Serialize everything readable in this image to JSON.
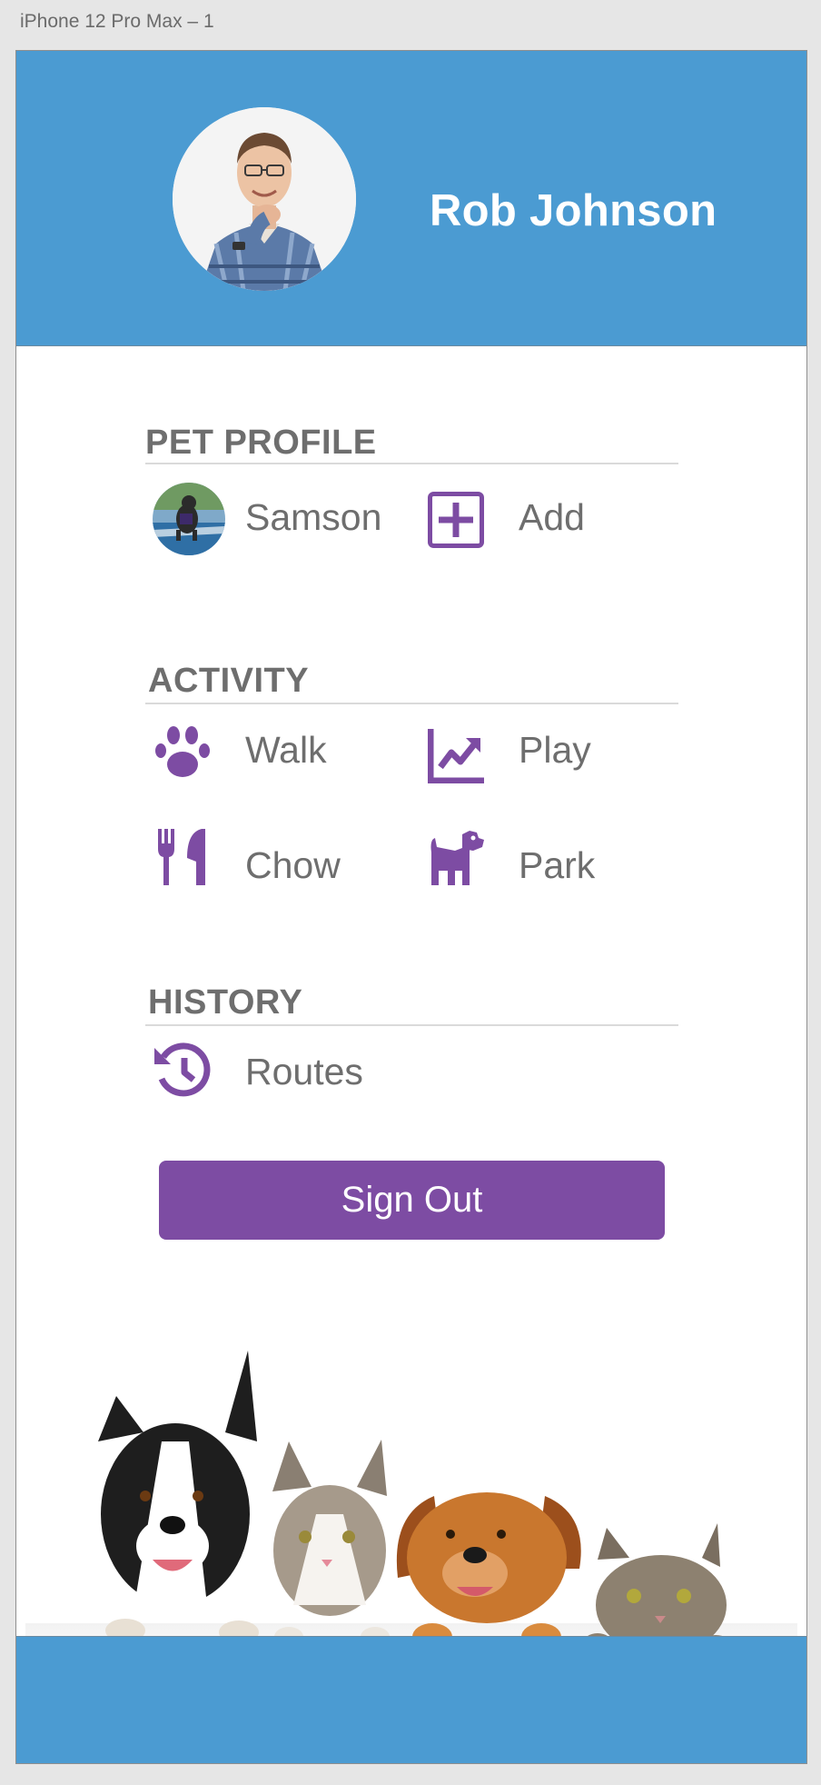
{
  "frame_title": "iPhone 12 Pro Max – 1",
  "user": {
    "name": "Rob Johnson"
  },
  "pet_profile": {
    "title": "PET PROFILE",
    "pet_name": "Samson",
    "add_label": "Add"
  },
  "activity": {
    "title": "ACTIVITY",
    "items": [
      {
        "label": "Walk",
        "icon": "paw-icon"
      },
      {
        "label": "Play",
        "icon": "chart-line-icon"
      },
      {
        "label": "Chow",
        "icon": "utensils-icon"
      },
      {
        "label": "Park",
        "icon": "dog-icon"
      }
    ]
  },
  "history": {
    "title": "HISTORY",
    "items": [
      {
        "label": "Routes",
        "icon": "history-icon"
      }
    ]
  },
  "sign_out_label": "Sign Out",
  "colors": {
    "header": "#4b9bd2",
    "accent": "#7d4ca3",
    "text": "#6e6e6e"
  }
}
